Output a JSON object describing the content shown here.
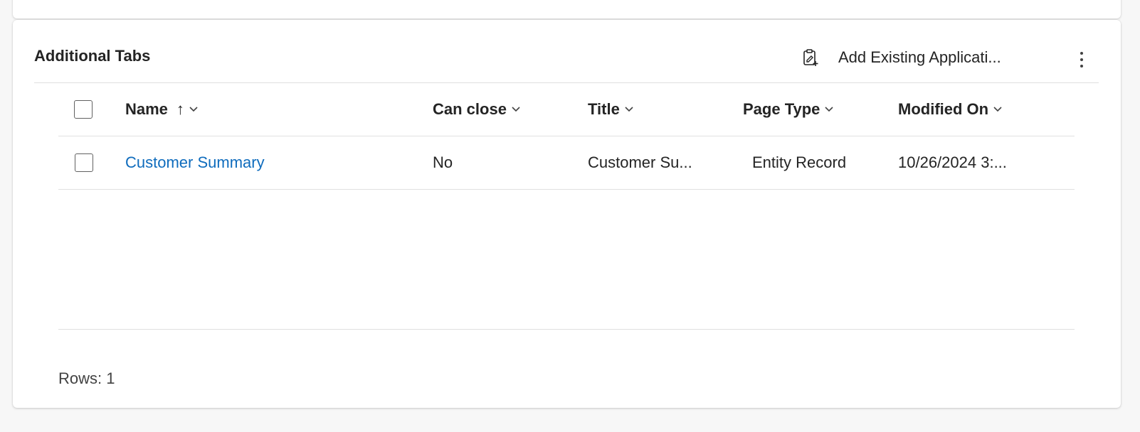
{
  "section": {
    "title": "Additional Tabs"
  },
  "commands": {
    "add_existing_label": "Add Existing Applicati...",
    "add_existing_icon": "clipboard-add-icon",
    "more_icon": "more-vertical-icon"
  },
  "grid": {
    "columns": [
      {
        "label": "Name",
        "sort": "ascending",
        "sort_glyph": "↑"
      },
      {
        "label": "Can close"
      },
      {
        "label": "Title"
      },
      {
        "label": "Page Type"
      },
      {
        "label": "Modified On"
      }
    ],
    "rows": [
      {
        "name": "Customer Summary",
        "can_close": "No",
        "title": "Customer Su...",
        "page_type": "Entity Record",
        "modified_on": "10/26/2024 3:..."
      }
    ],
    "footer": "Rows: 1"
  },
  "colors": {
    "link": "#0f6cbd",
    "text": "#242424",
    "divider": "#e0e0e0",
    "page_background": "#f7f7f7"
  }
}
